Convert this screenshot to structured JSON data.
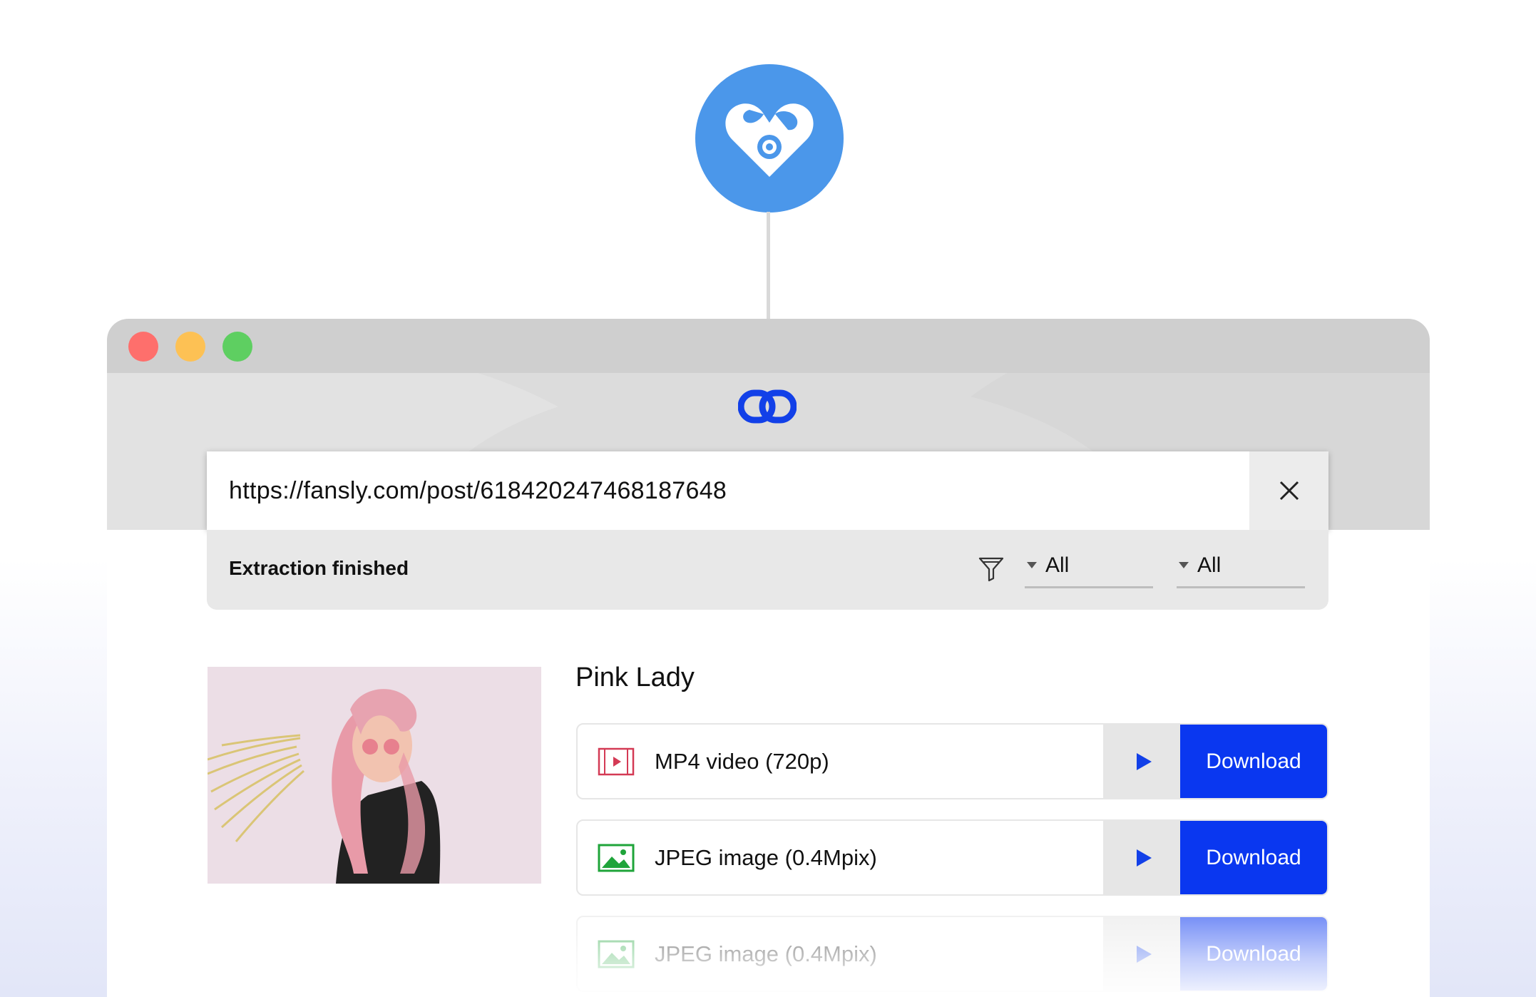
{
  "url_input": {
    "value": "https://fansly.com/post/618420247468187648"
  },
  "status": {
    "text": "Extraction finished"
  },
  "filters": [
    {
      "value": "All"
    },
    {
      "value": "All"
    }
  ],
  "media": {
    "title": "Pink Lady",
    "items": [
      {
        "icon": "video-file-icon",
        "label": "MP4 video (720p)",
        "download_label": "Download"
      },
      {
        "icon": "image-file-icon",
        "label": "JPEG image (0.4Mpix)",
        "download_label": "Download"
      },
      {
        "icon": "image-file-icon",
        "label": "JPEG image (0.4Mpix)",
        "download_label": "Download"
      }
    ]
  },
  "colors": {
    "source_logo": "#4b97ea",
    "download_button": "#0a37f0",
    "play_triangle": "#1240e8",
    "video_icon": "#d43a55",
    "image_icon": "#1fa43a"
  }
}
